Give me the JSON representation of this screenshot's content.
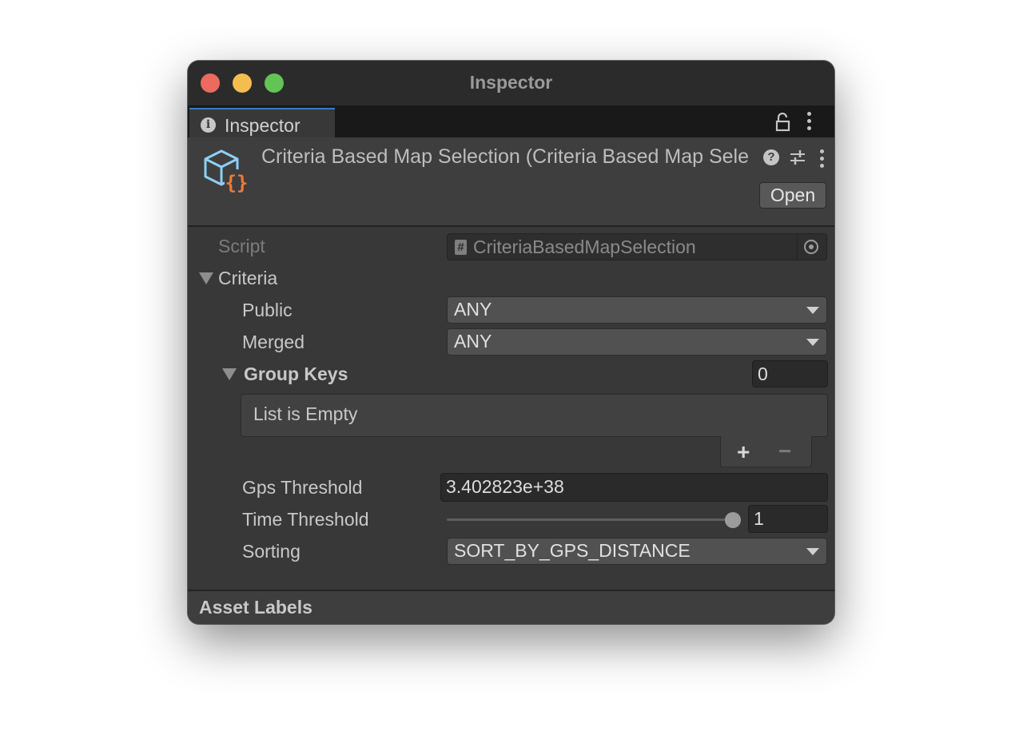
{
  "window": {
    "title": "Inspector"
  },
  "tab": {
    "label": "Inspector",
    "icon": "info-icon"
  },
  "header": {
    "title": "Criteria Based Map Selection (Criteria Based Map Selection)",
    "open_label": "Open",
    "help_glyph": "?"
  },
  "script_field": {
    "label": "Script",
    "value": "CriteriaBasedMapSelection",
    "hash_glyph": "#"
  },
  "criteria": {
    "label": "Criteria",
    "public": {
      "label": "Public",
      "value": "ANY"
    },
    "merged": {
      "label": "Merged",
      "value": "ANY"
    },
    "group_keys": {
      "label": "Group Keys",
      "count": "0",
      "empty_text": "List is Empty",
      "add_glyph": "+",
      "remove_glyph": "−"
    },
    "gps_threshold": {
      "label": "Gps Threshold",
      "value": "3.402823e+38"
    },
    "time_threshold": {
      "label": "Time Threshold",
      "value": "1",
      "slider_fraction": 1.0
    },
    "sorting": {
      "label": "Sorting",
      "value": "SORT_BY_GPS_DISTANCE"
    }
  },
  "footer": {
    "label": "Asset Labels"
  },
  "colors": {
    "close": "#ec6a5e",
    "minimize": "#f4be4f",
    "zoom": "#61c454",
    "tab_accent": "#3c78c8",
    "icon_cube": "#8ecff5",
    "icon_braces": "#ee7a3c"
  }
}
